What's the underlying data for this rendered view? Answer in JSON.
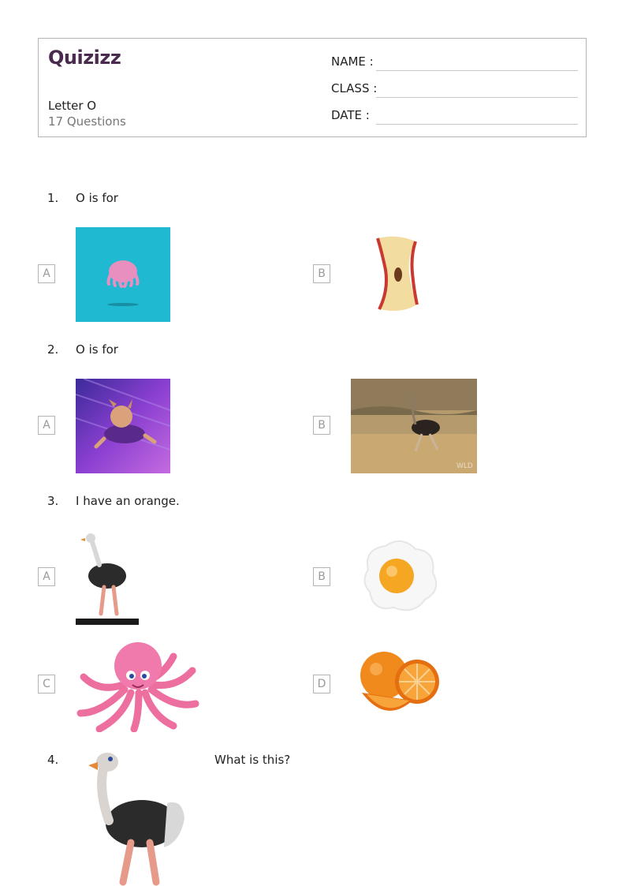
{
  "header": {
    "logo": "Quizizz",
    "title": "Letter O",
    "count": "17 Questions",
    "name_label": "NAME :",
    "class_label": "CLASS :",
    "date_label": "DATE  :"
  },
  "questions": [
    {
      "number": "1.",
      "text": "O is for",
      "options": [
        {
          "letter": "A",
          "image": "octopus-tile-image"
        },
        {
          "letter": "B",
          "image": "apple-core-image"
        }
      ]
    },
    {
      "number": "2.",
      "text": "O is for",
      "options": [
        {
          "letter": "A",
          "image": "flying-dog-image"
        },
        {
          "letter": "B",
          "image": "running-ostrich-photo"
        }
      ]
    },
    {
      "number": "3.",
      "text": "I have an orange.",
      "options": [
        {
          "letter": "A",
          "image": "ostrich-cartoon-image"
        },
        {
          "letter": "B",
          "image": "fried-egg-image"
        },
        {
          "letter": "C",
          "image": "pink-octopus-image"
        },
        {
          "letter": "D",
          "image": "orange-fruit-image"
        }
      ]
    },
    {
      "number": "4.",
      "text": "What is this?",
      "image": "ostrich-image"
    }
  ],
  "colors": {
    "logo": "#4a2a4e",
    "border": "#b4b4b4",
    "muted_text": "#777777"
  }
}
